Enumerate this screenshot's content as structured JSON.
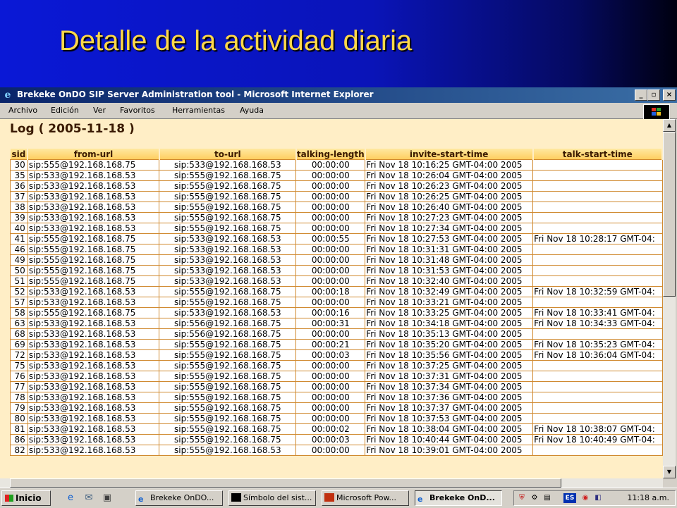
{
  "slide": {
    "title": "Detalle de la actividad diaria"
  },
  "window": {
    "title": "Brekeke OnDO SIP Server Administration tool - Microsoft Internet Explorer",
    "minimize": "_",
    "maximize": "▫",
    "close": "×"
  },
  "menu": {
    "items": [
      "Archivo",
      "Edición",
      "Ver",
      "Favoritos",
      "Herramientas",
      "Ayuda"
    ]
  },
  "log": {
    "title": "Log ( 2005-11-18 )",
    "columns": [
      "sid",
      "from-url",
      "to-url",
      "talking-length",
      "invite-start-time",
      "talk-start-time"
    ],
    "rows": [
      [
        "30",
        "sip:555@192.168.168.75",
        "sip:533@192.168.168.53",
        "00:00:00",
        "Fri Nov 18 10:16:25 GMT-04:00 2005",
        ""
      ],
      [
        "35",
        "sip:533@192.168.168.53",
        "sip:555@192.168.168.75",
        "00:00:00",
        "Fri Nov 18 10:26:04 GMT-04:00 2005",
        ""
      ],
      [
        "36",
        "sip:533@192.168.168.53",
        "sip:555@192.168.168.75",
        "00:00:00",
        "Fri Nov 18 10:26:23 GMT-04:00 2005",
        ""
      ],
      [
        "37",
        "sip:533@192.168.168.53",
        "sip:555@192.168.168.75",
        "00:00:00",
        "Fri Nov 18 10:26:25 GMT-04:00 2005",
        ""
      ],
      [
        "38",
        "sip:533@192.168.168.53",
        "sip:555@192.168.168.75",
        "00:00:00",
        "Fri Nov 18 10:26:40 GMT-04:00 2005",
        ""
      ],
      [
        "39",
        "sip:533@192.168.168.53",
        "sip:555@192.168.168.75",
        "00:00:00",
        "Fri Nov 18 10:27:23 GMT-04:00 2005",
        ""
      ],
      [
        "40",
        "sip:533@192.168.168.53",
        "sip:555@192.168.168.75",
        "00:00:00",
        "Fri Nov 18 10:27:34 GMT-04:00 2005",
        ""
      ],
      [
        "41",
        "sip:555@192.168.168.75",
        "sip:533@192.168.168.53",
        "00:00:55",
        "Fri Nov 18 10:27:53 GMT-04:00 2005",
        "Fri Nov 18 10:28:17 GMT-04:"
      ],
      [
        "46",
        "sip:555@192.168.168.75",
        "sip:533@192.168.168.53",
        "00:00:00",
        "Fri Nov 18 10:31:31 GMT-04:00 2005",
        ""
      ],
      [
        "49",
        "sip:555@192.168.168.75",
        "sip:533@192.168.168.53",
        "00:00:00",
        "Fri Nov 18 10:31:48 GMT-04:00 2005",
        ""
      ],
      [
        "50",
        "sip:555@192.168.168.75",
        "sip:533@192.168.168.53",
        "00:00:00",
        "Fri Nov 18 10:31:53 GMT-04:00 2005",
        ""
      ],
      [
        "51",
        "sip:555@192.168.168.75",
        "sip:533@192.168.168.53",
        "00:00:00",
        "Fri Nov 18 10:32:40 GMT-04:00 2005",
        ""
      ],
      [
        "52",
        "sip:533@192.168.168.53",
        "sip:555@192.168.168.75",
        "00:00:18",
        "Fri Nov 18 10:32:49 GMT-04:00 2005",
        "Fri Nov 18 10:32:59 GMT-04:"
      ],
      [
        "57",
        "sip:533@192.168.168.53",
        "sip:555@192.168.168.75",
        "00:00:00",
        "Fri Nov 18 10:33:21 GMT-04:00 2005",
        ""
      ],
      [
        "58",
        "sip:555@192.168.168.75",
        "sip:533@192.168.168.53",
        "00:00:16",
        "Fri Nov 18 10:33:25 GMT-04:00 2005",
        "Fri Nov 18 10:33:41 GMT-04:"
      ],
      [
        "63",
        "sip:533@192.168.168.53",
        "sip:556@192.168.168.75",
        "00:00:31",
        "Fri Nov 18 10:34:18 GMT-04:00 2005",
        "Fri Nov 18 10:34:33 GMT-04:"
      ],
      [
        "68",
        "sip:533@192.168.168.53",
        "sip:556@192.168.168.75",
        "00:00:00",
        "Fri Nov 18 10:35:13 GMT-04:00 2005",
        ""
      ],
      [
        "69",
        "sip:533@192.168.168.53",
        "sip:555@192.168.168.75",
        "00:00:21",
        "Fri Nov 18 10:35:20 GMT-04:00 2005",
        "Fri Nov 18 10:35:23 GMT-04:"
      ],
      [
        "72",
        "sip:533@192.168.168.53",
        "sip:555@192.168.168.75",
        "00:00:03",
        "Fri Nov 18 10:35:56 GMT-04:00 2005",
        "Fri Nov 18 10:36:04 GMT-04:"
      ],
      [
        "75",
        "sip:533@192.168.168.53",
        "sip:555@192.168.168.75",
        "00:00:00",
        "Fri Nov 18 10:37:25 GMT-04:00 2005",
        ""
      ],
      [
        "76",
        "sip:533@192.168.168.53",
        "sip:555@192.168.168.75",
        "00:00:00",
        "Fri Nov 18 10:37:31 GMT-04:00 2005",
        ""
      ],
      [
        "77",
        "sip:533@192.168.168.53",
        "sip:555@192.168.168.75",
        "00:00:00",
        "Fri Nov 18 10:37:34 GMT-04:00 2005",
        ""
      ],
      [
        "78",
        "sip:533@192.168.168.53",
        "sip:555@192.168.168.75",
        "00:00:00",
        "Fri Nov 18 10:37:36 GMT-04:00 2005",
        ""
      ],
      [
        "79",
        "sip:533@192.168.168.53",
        "sip:555@192.168.168.75",
        "00:00:00",
        "Fri Nov 18 10:37:37 GMT-04:00 2005",
        ""
      ],
      [
        "80",
        "sip:533@192.168.168.53",
        "sip:555@192.168.168.75",
        "00:00:00",
        "Fri Nov 18 10:37:53 GMT-04:00 2005",
        ""
      ],
      [
        "81",
        "sip:533@192.168.168.53",
        "sip:555@192.168.168.75",
        "00:00:02",
        "Fri Nov 18 10:38:04 GMT-04:00 2005",
        "Fri Nov 18 10:38:07 GMT-04:"
      ],
      [
        "86",
        "sip:533@192.168.168.53",
        "sip:555@192.168.168.75",
        "00:00:03",
        "Fri Nov 18 10:40:44 GMT-04:00 2005",
        "Fri Nov 18 10:40:49 GMT-04:"
      ],
      [
        "82",
        "sip:533@192.168.168.53",
        "sip:555@192.168.168.53",
        "00:00:00",
        "Fri Nov 18 10:39:01 GMT-04:00 2005",
        ""
      ]
    ]
  },
  "taskbar": {
    "start_label": "Inicio",
    "tasks": [
      "Brekeke OnDO...",
      "Símbolo del sist...",
      "Microsoft Pow...",
      "Brekeke OnD..."
    ],
    "active_task": 3,
    "lang": "ES",
    "clock": "11:18 a.m."
  },
  "colors": {
    "slide_bg": "#0a18d6",
    "title_text": "#ffd84a",
    "page_bg": "#ffeec6",
    "table_border": "#d08a30",
    "header_gradient": "#ffcf60"
  }
}
